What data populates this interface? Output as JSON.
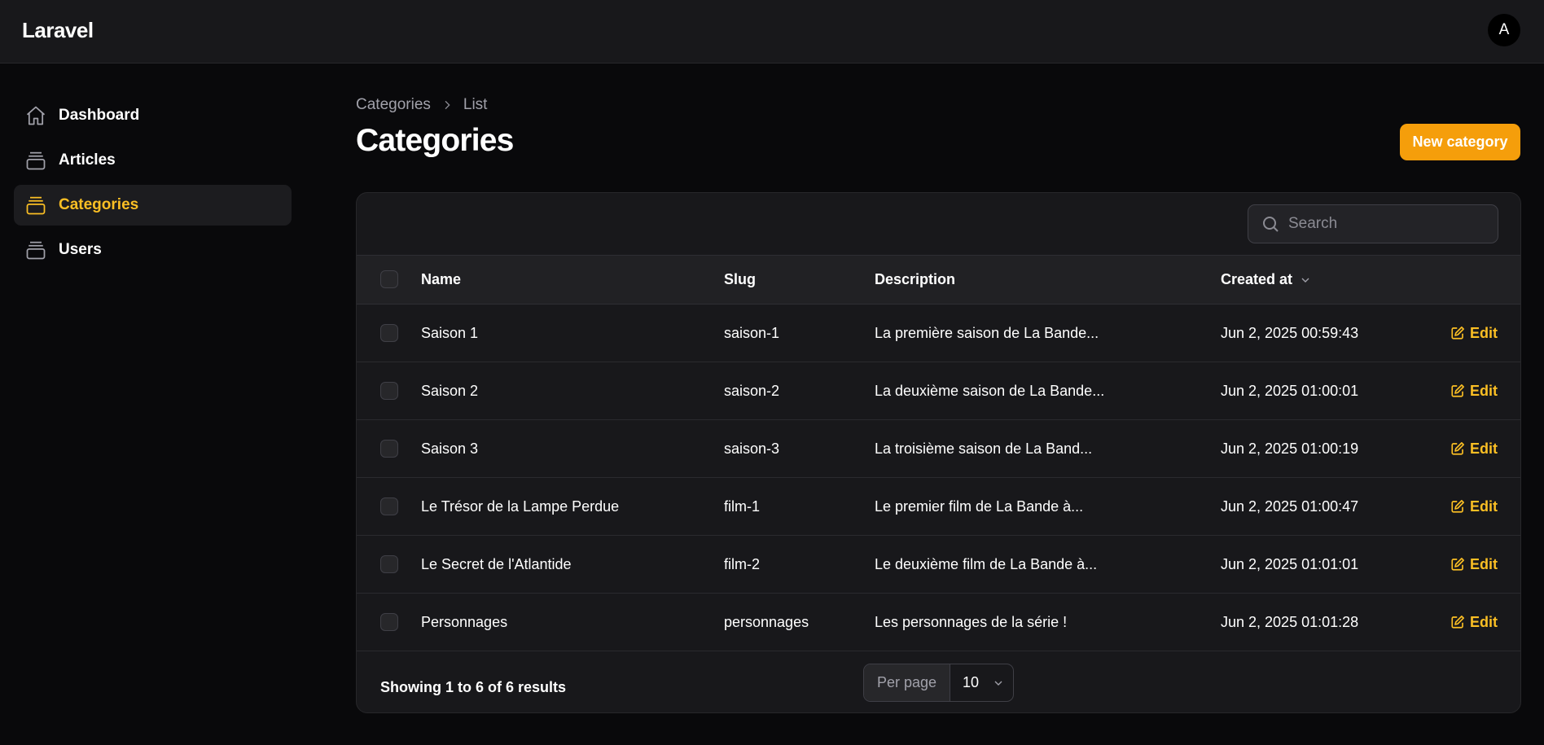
{
  "app": {
    "brand": "Laravel",
    "avatar_initial": "A"
  },
  "sidebar": {
    "items": [
      {
        "label": "Dashboard",
        "icon": "home-icon",
        "active": false
      },
      {
        "label": "Articles",
        "icon": "stack-icon",
        "active": false
      },
      {
        "label": "Categories",
        "icon": "stack-icon",
        "active": true
      },
      {
        "label": "Users",
        "icon": "stack-icon",
        "active": false
      }
    ]
  },
  "breadcrumb": {
    "root": "Categories",
    "current": "List"
  },
  "page": {
    "title": "Categories",
    "new_button": "New category"
  },
  "search": {
    "placeholder": "Search"
  },
  "table": {
    "columns": {
      "name": "Name",
      "slug": "Slug",
      "description": "Description",
      "created_at": "Created at"
    },
    "sort_column": "created_at",
    "rows": [
      {
        "name": "Saison 1",
        "slug": "saison-1",
        "description": "La première saison de La Bande...",
        "created_at": "Jun 2, 2025 00:59:43",
        "action": "Edit"
      },
      {
        "name": "Saison 2",
        "slug": "saison-2",
        "description": "La deuxième saison de La Bande...",
        "created_at": "Jun 2, 2025 01:00:01",
        "action": "Edit"
      },
      {
        "name": "Saison 3",
        "slug": "saison-3",
        "description": "La troisième saison de La Band...",
        "created_at": "Jun 2, 2025 01:00:19",
        "action": "Edit"
      },
      {
        "name": "Le Trésor de la Lampe Perdue",
        "slug": "film-1",
        "description": "Le premier film de La Bande à...",
        "created_at": "Jun 2, 2025 01:00:47",
        "action": "Edit"
      },
      {
        "name": "Le Secret de l'Atlantide",
        "slug": "film-2",
        "description": "Le deuxième film de La Bande à...",
        "created_at": "Jun 2, 2025 01:01:01",
        "action": "Edit"
      },
      {
        "name": "Personnages",
        "slug": "personnages",
        "description": "Les personnages de la série !",
        "created_at": "Jun 2, 2025 01:01:28",
        "action": "Edit"
      }
    ]
  },
  "pagination": {
    "summary": "Showing 1 to 6 of 6 results",
    "per_page_label": "Per page",
    "per_page_value": "10"
  },
  "colors": {
    "accent": "#f59e0b",
    "accent_text": "#fbbf24",
    "background": "#09090b",
    "surface": "#18181b"
  }
}
